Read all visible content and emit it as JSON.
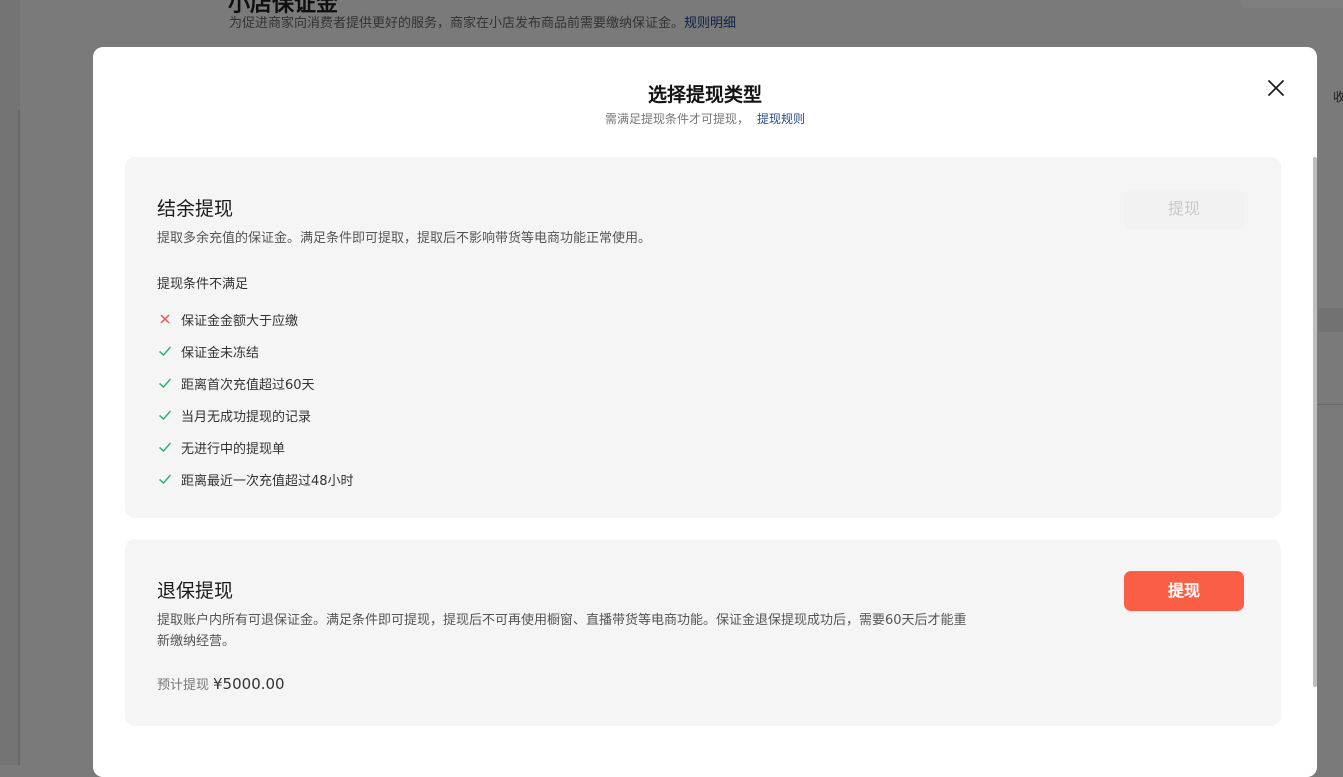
{
  "background": {
    "title": "小店保证金",
    "description": "为促进商家向消费者提供更好的服务，商家在小店发布商品前需要缴纳保证金。",
    "rule_link": "规则明细",
    "right_text": "收"
  },
  "modal": {
    "title": "选择提现类型",
    "subtitle": "需满足提现条件才可提现，",
    "rule_link": "提现规则",
    "close_icon": "close-icon"
  },
  "balance_withdraw": {
    "title": "结余提现",
    "description": "提取多余充值的保证金。满足条件即可提取，提取后不影响带货等电商功能正常使用。",
    "button_label": "提现",
    "button_state": "disabled",
    "conditions_title": "提现条件不满足",
    "conditions": [
      {
        "text": "保证金金额大于应缴",
        "met": false
      },
      {
        "text": "保证金未冻结",
        "met": true
      },
      {
        "text": "距离首次充值超过60天",
        "met": true
      },
      {
        "text": "当月无成功提现的记录",
        "met": true
      },
      {
        "text": "无进行中的提现单",
        "met": true
      },
      {
        "text": "距离最近一次充值超过48小时",
        "met": true
      }
    ]
  },
  "refund_withdraw": {
    "title": "退保提现",
    "description": "提取账户内所有可退保证金。满足条件即可提现，提现后不可再使用橱窗、直播带货等电商功能。保证金退保提现成功后，需要60天后才能重新缴纳经营。",
    "button_label": "提现",
    "button_state": "active",
    "estimate_label": "预计提现",
    "estimate_amount": "¥5000.00"
  },
  "colors": {
    "accent": "#fa5f45",
    "check": "#2bb673",
    "cross": "#f05050",
    "link": "#2a4a8a"
  }
}
